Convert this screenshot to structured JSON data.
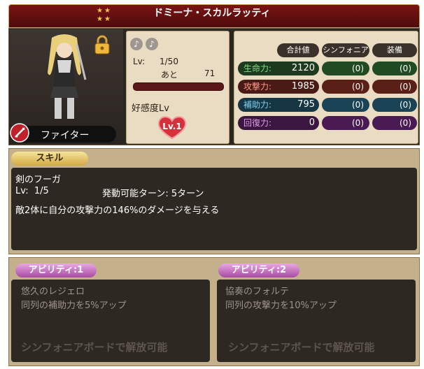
{
  "header": {
    "stars": "★★\n★★",
    "character_name": "ドミーナ・スカルラッティ"
  },
  "character": {
    "class_name": "ファイター"
  },
  "level_panel": {
    "lv_label": "Lv:",
    "lv_value": "1/50",
    "ato_label": "あと",
    "ato_value": "71",
    "affinity_label": "好感度Lv",
    "affinity_level": "Lv.1"
  },
  "stats": {
    "headers": [
      "合計値",
      "シンフォニア",
      "装備"
    ],
    "rows": [
      {
        "label": "生命力:",
        "value": "2120",
        "symphonia": "(0)",
        "equip": "(0)",
        "color": "#2e7d32"
      },
      {
        "label": "攻撃力:",
        "value": "1985",
        "symphonia": "(0)",
        "equip": "(0)",
        "color": "#8a2a22"
      },
      {
        "label": "補助力:",
        "value": "795",
        "symphonia": "(0)",
        "equip": "(0)",
        "color": "#1f5f78"
      },
      {
        "label": "回復力:",
        "value": "0",
        "symphonia": "(0)",
        "equip": "(0)",
        "color": "#6a2a7a"
      }
    ]
  },
  "skill": {
    "tab_label": "スキル",
    "name": "剣のフーガ",
    "lv_text": "Lv:  1/5",
    "turn_text": "発動可能ターン: 5ターン",
    "description": "敵2体に自分の攻撃力の146%のダメージを与える"
  },
  "abilities": [
    {
      "tab_label": "アビリティ:1",
      "name": "悠久のレジェロ",
      "effect": "同列の補助力を5%アップ",
      "unlock_text": "シンフォニアボードで解放可能"
    },
    {
      "tab_label": "アビリティ:2",
      "name": "協奏のフォルテ",
      "effect": "同列の攻撃力を10%アップ",
      "unlock_text": "シンフォニアボードで解放可能"
    }
  ]
}
